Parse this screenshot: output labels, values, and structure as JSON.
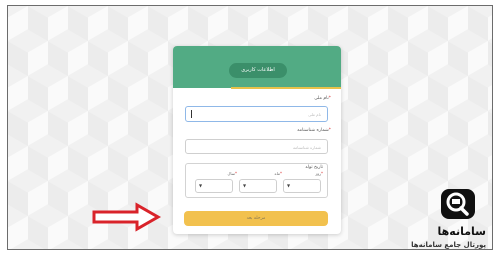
{
  "header": {
    "title": "اطلاعات کاربری"
  },
  "form": {
    "name_label": "نام ملی",
    "name_placeholder": "نام ملی",
    "id_label": "شماره شناسنامه",
    "id_placeholder": "شماره شناسنامه",
    "birthdate_label": "تاریخ تولد",
    "year_label": "سال",
    "month_label": "ماه",
    "day_label": "روز",
    "required_mark": "*",
    "submit_label": "مرحله بعد"
  },
  "branding": {
    "name": "سامانه‌ها",
    "tagline": "پورتال جامع سامانه‌ها"
  },
  "colors": {
    "header_green": "#52ab84",
    "accent_yellow": "#e8c24a",
    "submit_yellow": "#f2c14e",
    "arrow_red": "#d9232a"
  }
}
